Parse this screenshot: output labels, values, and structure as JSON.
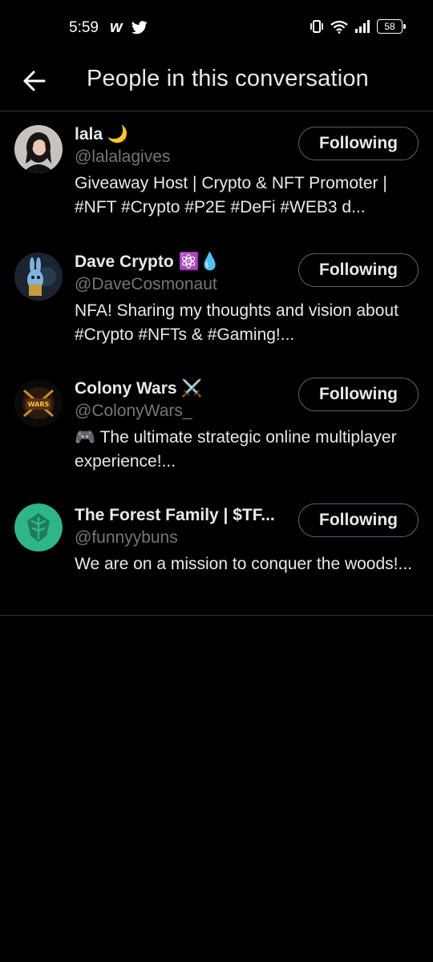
{
  "status_bar": {
    "time": "5:59",
    "app_icon_1": "w",
    "battery": "58",
    "icons": [
      "vibrate-icon",
      "wifi-icon",
      "signal-icon",
      "battery-icon"
    ]
  },
  "header": {
    "title": "People in this conversation",
    "back_icon": "arrow-left-icon"
  },
  "people": [
    {
      "name": "lala 🌙",
      "handle": "@lalalagives",
      "bio": "Giveaway Host | Crypto & NFT Promoter | #NFT #Crypto #P2E #DeFi  #WEB3 d...",
      "button": "Following"
    },
    {
      "name": "Dave Crypto ⚛️💧",
      "handle": "@DaveCosmonaut",
      "bio": "NFA! Sharing my thoughts and vision about #Crypto #NFTs & #Gaming!...",
      "button": "Following"
    },
    {
      "name": "Colony Wars ⚔️",
      "handle": "@ColonyWars_",
      "bio": "🎮 The ultimate strategic online multiplayer experience!...",
      "button": "Following"
    },
    {
      "name": "The Forest Family | $TF...",
      "handle": "@funnyybuns",
      "bio": "We are on a mission to conquer the woods!...",
      "button": "Following"
    }
  ],
  "colors": {
    "background": "#000000",
    "text": "#e7e9ea",
    "secondary_text": "#71767b",
    "border": "#2f3336",
    "forest_avatar": "#2fb58a"
  }
}
